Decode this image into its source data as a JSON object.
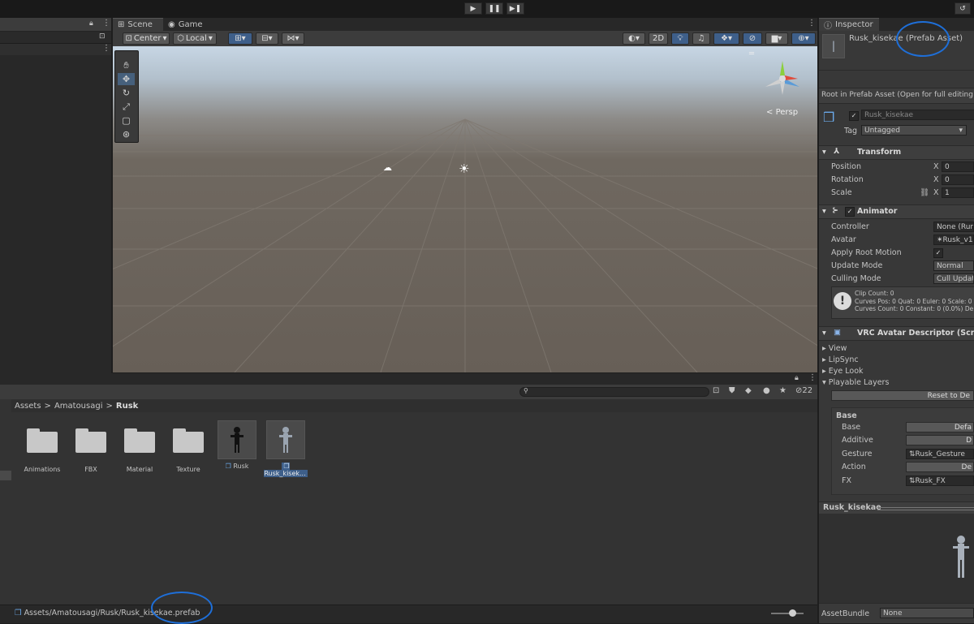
{
  "toolbar": {
    "play_icon": "play-icon",
    "pause_icon": "pause-icon",
    "step_icon": "step-icon",
    "history_icon": "history-icon"
  },
  "scene": {
    "tabs": [
      {
        "label": "Scene",
        "icon": "grid-icon"
      },
      {
        "label": "Game",
        "icon": "gamepad-icon"
      }
    ],
    "pivot_mode": "Center",
    "pivot_rotation": "Local",
    "mode_2d": "2D",
    "persp_label": "Persp"
  },
  "project": {
    "breadcrumb": [
      "Assets",
      "Amatousagi",
      "Rusk"
    ],
    "hidden_count": "22",
    "search_placeholder": "",
    "assets": [
      {
        "name": "Animations",
        "kind": "folder"
      },
      {
        "name": "FBX",
        "kind": "folder"
      },
      {
        "name": "Material",
        "kind": "folder"
      },
      {
        "name": "Texture",
        "kind": "folder"
      },
      {
        "name": "Rusk",
        "kind": "prefab"
      },
      {
        "name": "Rusk_kisek...",
        "kind": "prefab"
      }
    ],
    "status_path": "Assets/Amatousagi/Rusk/Rusk_kisekae.prefab"
  },
  "inspector": {
    "tab_label": "Inspector",
    "asset_title": "Rusk_kisekae (Prefab Asset)",
    "root_note": "Root in Prefab Asset (Open for full editing s",
    "object_name": "Rusk_kisekae",
    "tag_label": "Tag",
    "tag_value": "Untagged",
    "transform": {
      "title": "Transform",
      "rows": [
        {
          "label": "Position",
          "axis": "X",
          "value": "0"
        },
        {
          "label": "Rotation",
          "axis": "X",
          "value": "0"
        },
        {
          "label": "Scale",
          "axis": "X",
          "value": "1"
        }
      ]
    },
    "animator": {
      "title": "Animator",
      "rows": [
        {
          "label": "Controller",
          "value": "None (Runt"
        },
        {
          "label": "Avatar",
          "value": "Rusk_v1."
        },
        {
          "label": "Apply Root Motion",
          "value": "✓"
        },
        {
          "label": "Update Mode",
          "value": "Normal"
        },
        {
          "label": "Culling Mode",
          "value": "Cull Updat"
        }
      ],
      "info": [
        "Clip Count: 0",
        "Curves Pos: 0 Quat: 0 Euler: 0 Scale: 0",
        "Curves Count: 0 Constant: 0 (0.0%) De"
      ]
    },
    "vrc": {
      "title": "VRC Avatar Descriptor (Script)",
      "foldouts": [
        "View",
        "LipSync",
        "Eye Look",
        "Playable Layers"
      ],
      "reset_label": "Reset to De",
      "base_title": "Base",
      "layers": [
        {
          "label": "Base",
          "value": "Defa",
          "kind": "button"
        },
        {
          "label": "Additive",
          "value": "D",
          "kind": "button"
        },
        {
          "label": "Gesture",
          "value": "Rusk_Gesture",
          "kind": "field"
        },
        {
          "label": "Action",
          "value": "De",
          "kind": "button"
        },
        {
          "label": "FX",
          "value": "Rusk_FX",
          "kind": "field"
        }
      ]
    },
    "preview_title": "Rusk_kisekae",
    "assetbundle_label": "AssetBundle",
    "assetbundle_value": "None"
  }
}
